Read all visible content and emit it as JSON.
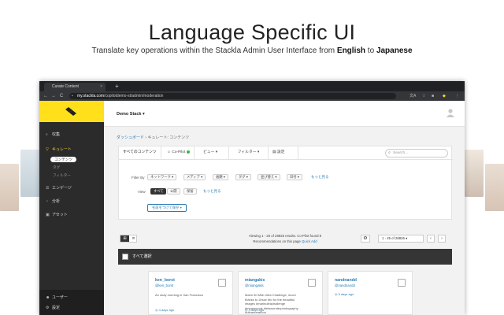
{
  "hero": {
    "title": "Language Specific UI",
    "subtitle_pre": "Translate key operations within the Stackla Admin User Interface from ",
    "lang_from": "English",
    "subtitle_mid": " to ",
    "lang_to": "Japanese"
  },
  "browser": {
    "tab_title": "Curate Content",
    "tab_close": "×",
    "new_tab": "+",
    "url_host": "my.stackla.com",
    "url_path": "/copilotdemo-st/admin/moderation",
    "nav_back": "←",
    "nav_forward": "→",
    "nav_reload": "C"
  },
  "sidebar": {
    "items": [
      {
        "icon": "⌕",
        "label": "収集"
      },
      {
        "icon": "▽",
        "label": "キュレート"
      },
      {
        "icon": "☰",
        "label": "エンゲージ"
      },
      {
        "icon": "◔",
        "label": "分析"
      },
      {
        "icon": "▣",
        "label": "アセット"
      }
    ],
    "sub_items": [
      "コンテンツ",
      "タグ",
      "フィルター"
    ],
    "footer_items": [
      {
        "icon": "☻",
        "label": "ユーザー"
      },
      {
        "icon": "⚙",
        "label": "設定"
      }
    ]
  },
  "topbar": {
    "stack_name": "Demo Stack",
    "stack_caret": "▾"
  },
  "breadcrumb": {
    "link": "ダッシュボード",
    "sep": " › ",
    "current": "キュレート: コンテンツ"
  },
  "filters": {
    "tabs": [
      "すべてのコンテンツ",
      "Co-Pilot",
      "ビュー ▾",
      "フィルター ▾",
      "▤ 設定"
    ],
    "search_placeholder": "Search...",
    "filter_by_label": "Filter By",
    "filter_chips": [
      "ネットワーク ▾",
      "メディア ▾",
      "画題 ▾",
      "タグ ▾",
      "並び替え ▾",
      "日付 ▾"
    ],
    "show_more": "もっと見る",
    "view_label": "View",
    "view_chips": [
      "すべて",
      "公開",
      "保留"
    ],
    "view_more": "もっと見る",
    "save_button": "名前をつけて保存 ▾"
  },
  "results": {
    "grid_icon": "⊞",
    "list_icon": "≣",
    "viewing_text": "Viewing 1 - 25 of 28826 results. Co-Pilot found 8",
    "recommend_text": "Recommendations on this page",
    "quick_add": "Quick Add",
    "settings_icon": "⚙",
    "pager_text": "1 - 25 of 28826",
    "prev": "‹",
    "next": "›",
    "select_all": "すべて選択"
  },
  "cards": [
    {
      "name": "ken_borst",
      "handle": "@ken_borst",
      "text": "An okay morning in San Francisco",
      "time": "4 days ago"
    },
    {
      "name": "miangakis",
      "handle": "@miangakis",
      "text": "Marin 50 Mile Ultra Challenge, much thanks to Jesse Itfo for the beautiful images #marinultrachallenge #mumwoods #letswonderphotography #ultramarathon",
      "time": "4 days ago"
    },
    {
      "name": "nandnandd",
      "handle": "@nandnandd",
      "text": "",
      "time": "5 days ago"
    }
  ],
  "colors": {
    "brand_yellow": "#ffe01b",
    "link_blue": "#2a7ab0",
    "sidebar_dark": "#2b2b2b",
    "copilot_green": "#3bb54a"
  }
}
